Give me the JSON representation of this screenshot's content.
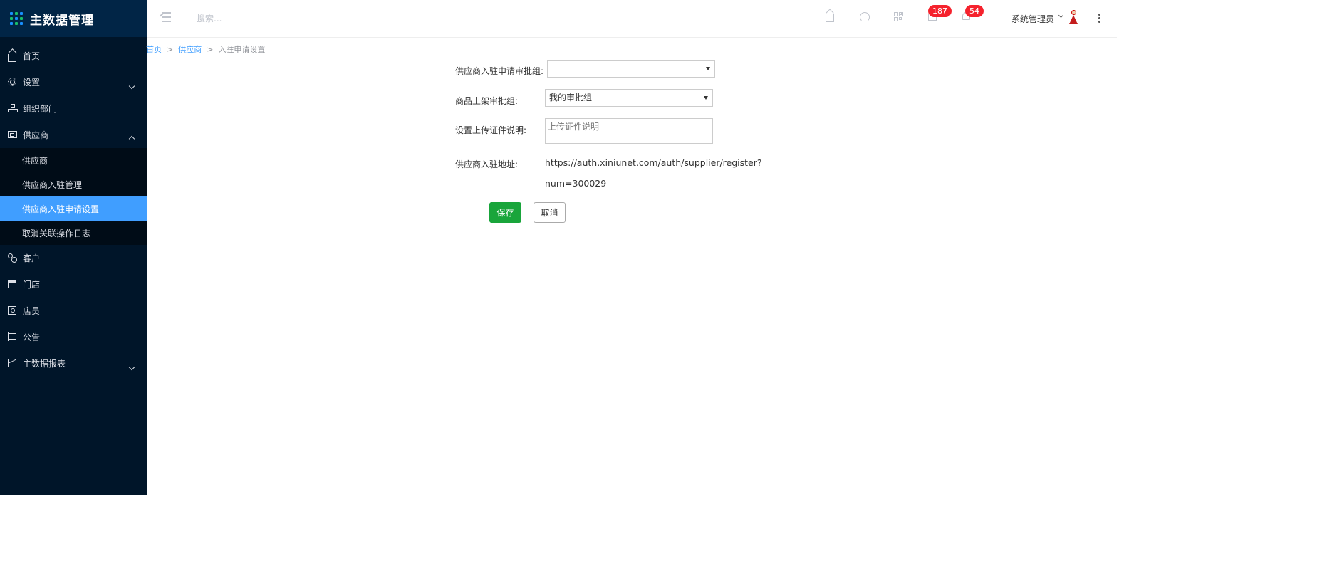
{
  "app": {
    "title": "主数据管理"
  },
  "sidebar": {
    "items": [
      {
        "label": "首页"
      },
      {
        "label": "设置"
      },
      {
        "label": "组织部门"
      },
      {
        "label": "供应商"
      },
      {
        "label": "客户"
      },
      {
        "label": "门店"
      },
      {
        "label": "店员"
      },
      {
        "label": "公告"
      },
      {
        "label": "主数据报表"
      }
    ],
    "supplier_sub": [
      {
        "label": "供应商"
      },
      {
        "label": "供应商入驻管理"
      },
      {
        "label": "供应商入驻申请设置"
      },
      {
        "label": "取消关联操作日志"
      }
    ]
  },
  "header": {
    "search_placeholder": "搜索...",
    "mail_badge": "187",
    "bell_badge": "54",
    "user_name": "系统管理员"
  },
  "breadcrumb": {
    "home": "首页",
    "supplier": "供应商",
    "sep1": ">",
    "sep2": ">",
    "current": "入驻申请设置"
  },
  "form": {
    "approval_group_label": "供应商入驻申请审批组:",
    "approval_group_value": "",
    "goods_group_label": "商品上架审批组:",
    "goods_group_value": "我的审批组",
    "cert_label": "设置上传证件说明:",
    "cert_placeholder": "上传证件说明",
    "address_label": "供应商入驻地址:",
    "address_line1": "https://auth.xiniunet.com/auth/supplier/register?",
    "address_line2": "num=300029",
    "save_label": "保存",
    "cancel_label": "取消"
  }
}
